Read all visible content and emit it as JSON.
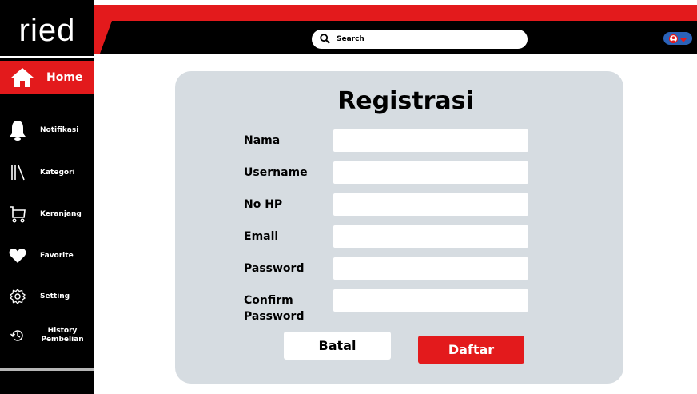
{
  "app": {
    "logo": "ried"
  },
  "colors": {
    "accent": "#e31a1c",
    "sidebar": "#000000",
    "card": "#d6dce1",
    "profile": "#2b62b8"
  },
  "search": {
    "label": "Search",
    "icon": "search-icon"
  },
  "sidebar": {
    "home": {
      "label": "Home",
      "icon": "home-icon"
    },
    "items": [
      {
        "label": "Notifikasi",
        "icon": "bell-icon"
      },
      {
        "label": "Kategori",
        "icon": "library-icon"
      },
      {
        "label": "Keranjang",
        "icon": "cart-icon"
      },
      {
        "label": "Favorite",
        "icon": "heart-icon"
      },
      {
        "label": "Setting",
        "icon": "gear-icon"
      },
      {
        "label": "History Pembelian",
        "icon": "history-icon"
      }
    ]
  },
  "form": {
    "title": "Registrasi",
    "fields": [
      {
        "label": "Nama",
        "value": ""
      },
      {
        "label": "Username",
        "value": ""
      },
      {
        "label": "No HP",
        "value": ""
      },
      {
        "label": "Email",
        "value": ""
      },
      {
        "label": "Password",
        "value": ""
      },
      {
        "label": "Confirm Password",
        "value": ""
      }
    ],
    "cancel_label": "Batal",
    "submit_label": "Daftar"
  }
}
